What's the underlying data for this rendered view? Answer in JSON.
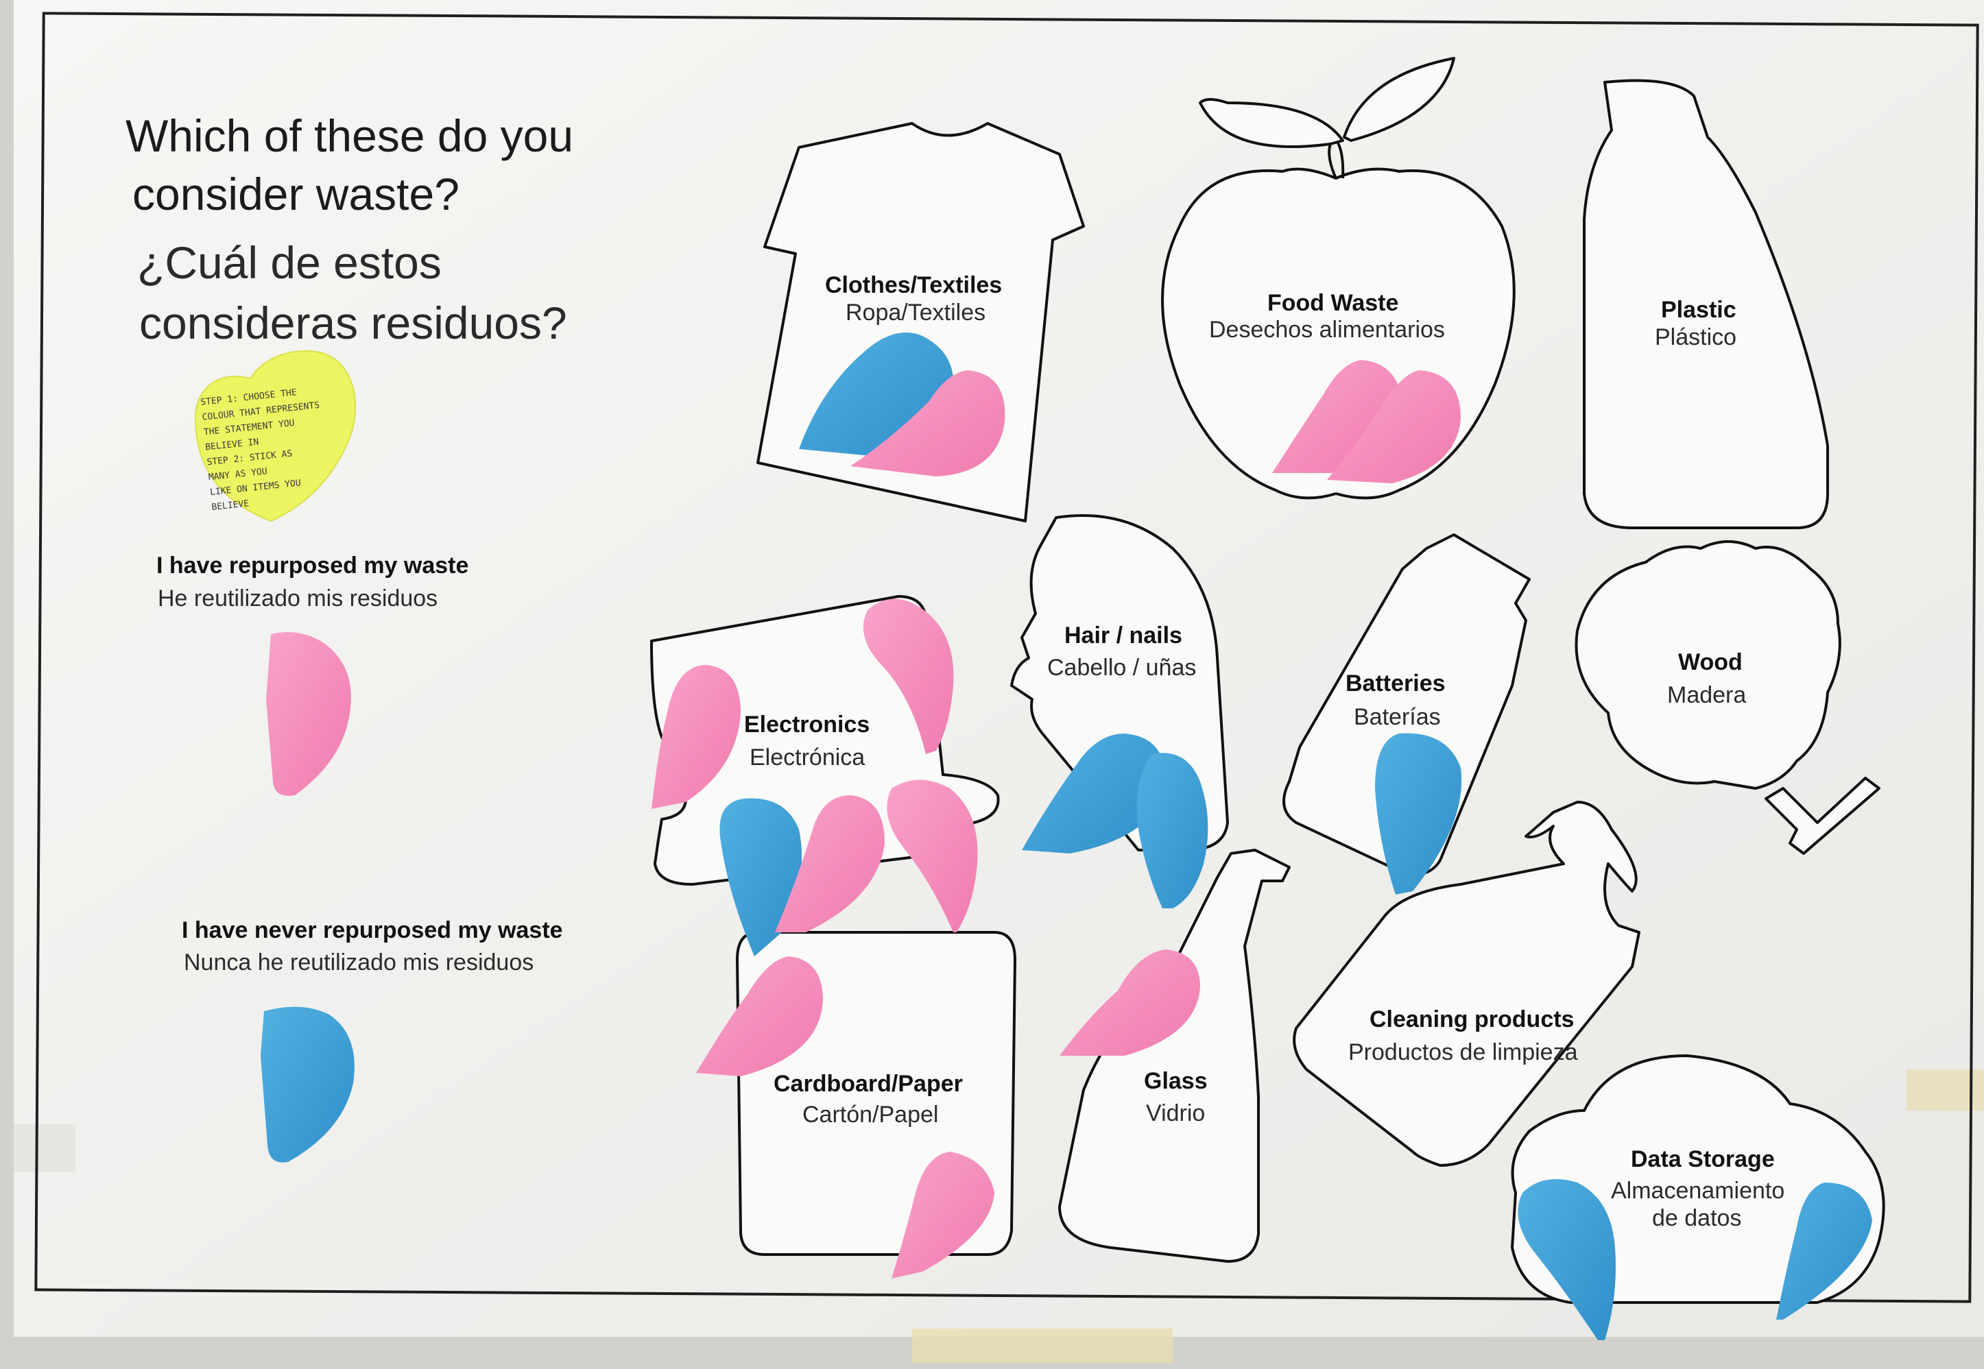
{
  "heading": {
    "en_line1": "Which of these do you",
    "en_line2": "consider waste?",
    "es_line1": "¿Cuál de estos",
    "es_line2": "consideras residuos?"
  },
  "sticky_note": {
    "lines": [
      "STEP 1: CHOOSE THE",
      "COLOUR THAT REPRESENTS",
      "THE STATEMENT YOU",
      "BELIEVE IN",
      "STEP 2: STICK AS",
      "MANY AS YOU",
      "LIKE ON ITEMS YOU",
      "BELIEVE"
    ]
  },
  "legend": {
    "repurposed_en": "I have repurposed my waste",
    "repurposed_es": "He reutilizado mis residuos",
    "never_en": "I have never repurposed my waste",
    "never_es": "Nunca he reutilizado mis residuos"
  },
  "categories": {
    "clothes": {
      "en": "Clothes/Textiles",
      "es": "Ropa/Textiles",
      "pink_votes": 1,
      "blue_votes": 1
    },
    "food": {
      "en": "Food Waste",
      "es": "Desechos alimentarios",
      "pink_votes": 2,
      "blue_votes": 0
    },
    "plastic": {
      "en": "Plastic",
      "es": "Plástico",
      "pink_votes": 0,
      "blue_votes": 0
    },
    "electronics": {
      "en": "Electronics",
      "es": "Electrónica",
      "pink_votes": 4,
      "blue_votes": 1
    },
    "hair": {
      "en": "Hair / nails",
      "es": "Cabello / uñas",
      "pink_votes": 0,
      "blue_votes": 2
    },
    "batteries": {
      "en": "Batteries",
      "es": "Baterías",
      "pink_votes": 0,
      "blue_votes": 1
    },
    "wood": {
      "en": "Wood",
      "es": "Madera",
      "pink_votes": 0,
      "blue_votes": 0
    },
    "cardboard": {
      "en": "Cardboard/Paper",
      "es": "Cartón/Papel",
      "pink_votes": 2,
      "blue_votes": 0
    },
    "glass": {
      "en": "Glass",
      "es": "Vidrio",
      "pink_votes": 1,
      "blue_votes": 0
    },
    "cleaning": {
      "en": "Cleaning products",
      "es": "Productos de limpieza",
      "pink_votes": 0,
      "blue_votes": 0
    },
    "data": {
      "en": "Data Storage",
      "es_line1": "Almacenamiento",
      "es_line2": "de datos",
      "pink_votes": 0,
      "blue_votes": 2
    }
  },
  "colors": {
    "pink": "#f78fbd",
    "blue": "#3ea0d6",
    "yellow_note": "#eef56a",
    "board": "#f3f3f1",
    "wall": "#d6d6d0"
  }
}
